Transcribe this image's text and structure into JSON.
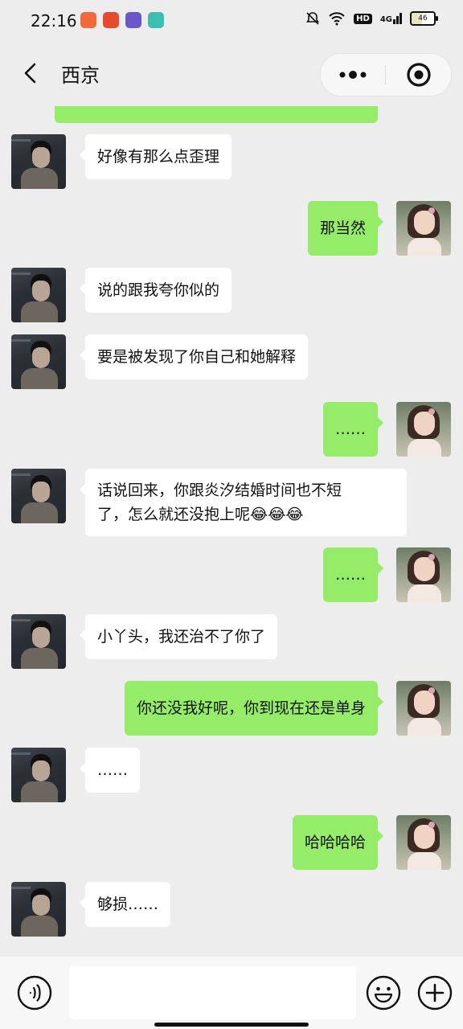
{
  "status": {
    "time": "22:16",
    "hd": "HD",
    "network": "4G",
    "battery": "46",
    "app_icon_colors": [
      "#f06a3a",
      "#e84a2c",
      "#6b57c7",
      "#3bbfb0"
    ]
  },
  "nav": {
    "title": "西京",
    "icons": [
      "back-arrow-icon",
      "more-icon",
      "record-target-icon"
    ]
  },
  "colors": {
    "self_bubble": "#95ec69",
    "other_bubble": "#ffffff",
    "background": "#ededed"
  },
  "messages": [
    {
      "side": "left",
      "text": "好像有那么点歪理"
    },
    {
      "side": "right",
      "text": "那当然"
    },
    {
      "side": "left",
      "text": "说的跟我夸你似的"
    },
    {
      "side": "left",
      "text": "要是被发现了你自己和她解释"
    },
    {
      "side": "right",
      "text": "……"
    },
    {
      "side": "left",
      "line1": "话说回来，你跟炎汐结婚时间也不短",
      "line2": "了，怎么就还没抱上呢😂😂😂"
    },
    {
      "side": "right",
      "text": "……"
    },
    {
      "side": "left",
      "text": "小丫头，我还治不了你了"
    },
    {
      "side": "right",
      "text": "你还没我好呢，你到现在还是单身"
    },
    {
      "side": "left",
      "text": "……"
    },
    {
      "side": "right",
      "text": "哈哈哈哈"
    },
    {
      "side": "left",
      "text": "够损……"
    }
  ],
  "input": {
    "value": "",
    "icons": [
      "voice-icon",
      "emoji-icon",
      "plus-icon"
    ]
  }
}
